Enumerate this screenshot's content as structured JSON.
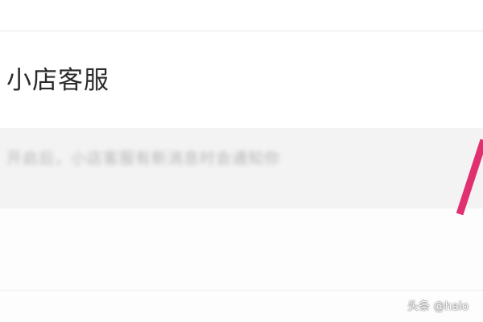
{
  "header_partial": {
    "text": ""
  },
  "setting": {
    "title": "小店客服",
    "description": "开启后，小店客服有新消息时会通知你"
  },
  "next_setting": {
    "label": ""
  },
  "annotation": {
    "color": "#e0306f"
  },
  "watermark": {
    "text": "头条 @halo"
  }
}
